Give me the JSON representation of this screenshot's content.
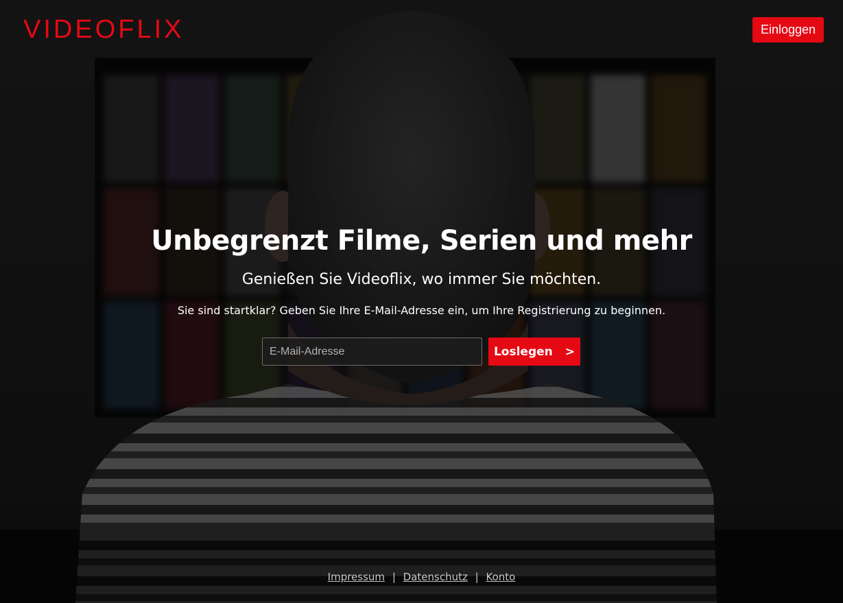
{
  "header": {
    "logo": "VIDEOFLIX",
    "login_label": "Einloggen"
  },
  "hero": {
    "title": "Unbegrenzt Filme, Serien und mehr",
    "subtitle": "Genießen Sie Videoflix, wo immer Sie möchten.",
    "cta_text": "Sie sind startklar? Geben Sie Ihre E-Mail-Adresse ein, um Ihre Registrierung zu beginnen.",
    "email_placeholder": "E-Mail-Adresse",
    "email_value": "",
    "start_label": "Loslegen",
    "start_arrow": ">"
  },
  "footer": {
    "links": [
      "Impressum",
      "Datenschutz",
      "Konto"
    ],
    "separator": "|"
  },
  "colors": {
    "accent": "#e50914",
    "background": "#0c0c0c",
    "footer_text": "#c8c8c8"
  },
  "icons": {
    "background_image": "person-watching-tv-photo"
  }
}
